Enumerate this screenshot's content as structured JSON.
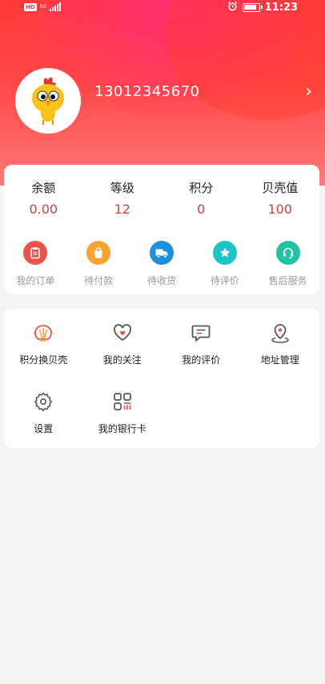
{
  "status_bar": {
    "hd": "HD",
    "network": "5G",
    "time": "11:23"
  },
  "profile": {
    "phone": "13012345670",
    "chevron": "›"
  },
  "stats": [
    {
      "label": "余额",
      "value": "0.00"
    },
    {
      "label": "等级",
      "value": "12"
    },
    {
      "label": "积分",
      "value": "0"
    },
    {
      "label": "贝壳值",
      "value": "100"
    }
  ],
  "orders": [
    {
      "label": "我的订单",
      "icon": "clipboard-icon",
      "color": "#e9534c"
    },
    {
      "label": "待付款",
      "icon": "bag-icon",
      "color": "#f6a333"
    },
    {
      "label": "待收货",
      "icon": "truck-icon",
      "color": "#1f8fdb"
    },
    {
      "label": "待评价",
      "icon": "star-icon",
      "color": "#1ec3c6"
    },
    {
      "label": "售后服务",
      "icon": "headset-icon",
      "color": "#23c2a6"
    }
  ],
  "tools": [
    {
      "label": "积分换贝壳",
      "icon": "shell-icon"
    },
    {
      "label": "我的关注",
      "icon": "heart-icon"
    },
    {
      "label": "我的评价",
      "icon": "comment-icon"
    },
    {
      "label": "地址管理",
      "icon": "location-icon"
    },
    {
      "label": "设置",
      "icon": "gear-icon"
    },
    {
      "label": "我的银行卡",
      "icon": "bank-card-icon"
    }
  ],
  "colors": {
    "header": "#ff4040",
    "accent_value": "#c9463d",
    "icon_stroke": "#555555",
    "icon_accent": "#e9534c"
  }
}
